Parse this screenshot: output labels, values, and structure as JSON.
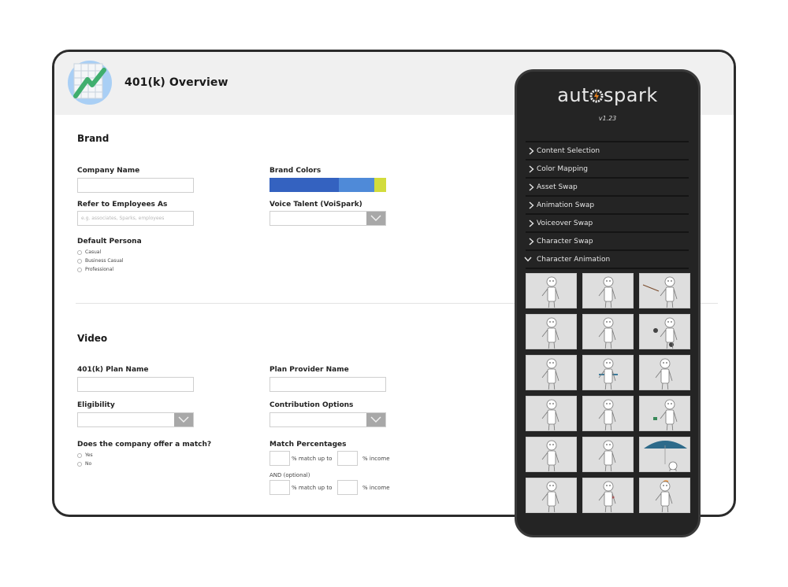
{
  "header": {
    "title": "401(k) Overview",
    "logo_icon": "growth-chart-icon"
  },
  "brand": {
    "section_title": "Brand",
    "company_name": {
      "label": "Company Name",
      "value": "",
      "placeholder": ""
    },
    "refer_employees": {
      "label": "Refer to Employees As",
      "value": "",
      "placeholder": "e.g. associates, Sparks, employees"
    },
    "default_persona": {
      "label": "Default Persona",
      "options": [
        "Casual",
        "Business Casual",
        "Professional"
      ],
      "selected": null
    },
    "brand_colors": {
      "label": "Brand Colors",
      "swatches": [
        "#3462c0",
        "#4f8ad8",
        "#d2dc3c"
      ]
    },
    "voice_talent": {
      "label": "Voice Talent (VoiSpark)",
      "value": ""
    }
  },
  "video": {
    "section_title": "Video",
    "plan_name": {
      "label": "401(k) Plan Name",
      "value": ""
    },
    "plan_provider": {
      "label": "Plan Provider Name",
      "value": ""
    },
    "eligibility": {
      "label": "Eligibility",
      "value": ""
    },
    "contribution_options": {
      "label": "Contribution Options",
      "value": ""
    },
    "offer_match": {
      "label": "Does the company offer a match?",
      "options": [
        "Yes",
        "No"
      ],
      "selected": null
    },
    "match_percentages": {
      "label": "Match Percentages",
      "match_text": "% match up to",
      "income_text": "% income",
      "optional_label": "AND (optional)",
      "rows": [
        {
          "match": "",
          "income": ""
        },
        {
          "match": "",
          "income": ""
        }
      ]
    }
  },
  "panel": {
    "brand_left": "aut",
    "brand_right": "spark",
    "brand_accent": "#e8821e",
    "version": "v1.23",
    "menu": [
      {
        "label": "Content Selection",
        "expanded": false
      },
      {
        "label": "Color Mapping",
        "expanded": false
      },
      {
        "label": "Asset Swap",
        "expanded": false
      },
      {
        "label": "Animation Swap",
        "expanded": false
      },
      {
        "label": "Voiceover Swap",
        "expanded": false
      },
      {
        "label": "Character Swap",
        "expanded": false
      },
      {
        "label": "Character Animation",
        "expanded": true
      }
    ],
    "animations": [
      "thumbs-up",
      "shrug",
      "pointer-stick",
      "wave-thumbs",
      "phone-call",
      "dumbbells",
      "thinking",
      "jump-rope",
      "glasses",
      "check-watch",
      "binoculars",
      "hand-money",
      "standing",
      "walking",
      "umbrella",
      "surprised",
      "business-wave",
      "confused"
    ]
  }
}
